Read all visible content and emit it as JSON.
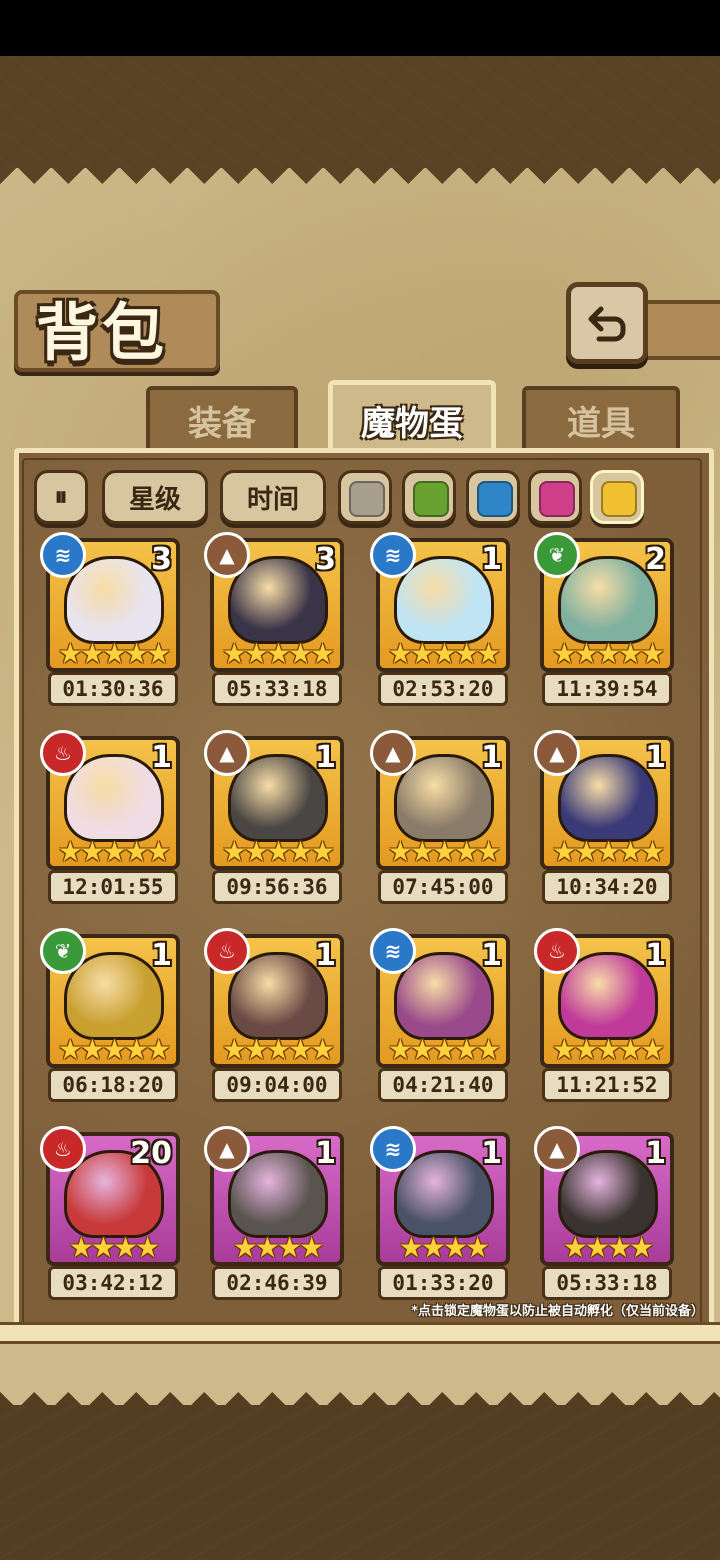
{
  "header": {
    "title": "背包",
    "back_icon": "back-arrow-icon"
  },
  "tabs": [
    {
      "label": "装备",
      "active": false
    },
    {
      "label": "魔物蛋",
      "active": true
    },
    {
      "label": "道具",
      "active": false
    }
  ],
  "filters": {
    "toggle_icon": "sort-toggle-icon",
    "star_label": "星级",
    "time_label": "时间",
    "colors": [
      {
        "name": "gray",
        "hex": "#a89e8c",
        "selected": false
      },
      {
        "name": "green",
        "hex": "#6aa232",
        "selected": false
      },
      {
        "name": "blue",
        "hex": "#2e86c8",
        "selected": false
      },
      {
        "name": "pink",
        "hex": "#d0408a",
        "selected": false
      },
      {
        "name": "gold",
        "hex": "#f0c030",
        "selected": true
      }
    ]
  },
  "eggs": [
    {
      "element": "water",
      "count": "3",
      "stars": "★★★★★",
      "timer": "01:30:36",
      "rarity": "gold",
      "color": "#e8e4f0"
    },
    {
      "element": "earth",
      "count": "3",
      "stars": "★★★★★",
      "timer": "05:33:18",
      "rarity": "gold",
      "color": "#3a3448"
    },
    {
      "element": "water",
      "count": "1",
      "stars": "★★★★★",
      "timer": "02:53:20",
      "rarity": "gold",
      "color": "#bfe4f4"
    },
    {
      "element": "wood",
      "count": "2",
      "stars": "★★★★★",
      "timer": "11:39:54",
      "rarity": "gold",
      "color": "#7fb0a0"
    },
    {
      "element": "fire",
      "count": "1",
      "stars": "★★★★★",
      "timer": "12:01:55",
      "rarity": "gold",
      "color": "#f0dce4"
    },
    {
      "element": "earth",
      "count": "1",
      "stars": "★★★★★",
      "timer": "09:56:36",
      "rarity": "gold",
      "color": "#4a4644"
    },
    {
      "element": "earth",
      "count": "1",
      "stars": "★★★★★",
      "timer": "07:45:00",
      "rarity": "gold",
      "color": "#8a7c6a"
    },
    {
      "element": "earth",
      "count": "1",
      "stars": "★★★★★",
      "timer": "10:34:20",
      "rarity": "gold",
      "color": "#3a3a78"
    },
    {
      "element": "wood",
      "count": "1",
      "stars": "★★★★★",
      "timer": "06:18:20",
      "rarity": "gold",
      "color": "#c8a030"
    },
    {
      "element": "fire",
      "count": "1",
      "stars": "★★★★★",
      "timer": "09:04:00",
      "rarity": "gold",
      "color": "#6a4a44"
    },
    {
      "element": "water",
      "count": "1",
      "stars": "★★★★★",
      "timer": "04:21:40",
      "rarity": "gold",
      "color": "#9a4a8a"
    },
    {
      "element": "fire",
      "count": "1",
      "stars": "★★★★★",
      "timer": "11:21:52",
      "rarity": "gold",
      "color": "#c03a9a"
    },
    {
      "element": "fire",
      "count": "20",
      "stars": "★★★★",
      "timer": "03:42:12",
      "rarity": "purple",
      "color": "#c83a3a"
    },
    {
      "element": "earth",
      "count": "1",
      "stars": "★★★★",
      "timer": "02:46:39",
      "rarity": "purple",
      "color": "#5a5450"
    },
    {
      "element": "water",
      "count": "1",
      "stars": "★★★★",
      "timer": "01:33:20",
      "rarity": "purple",
      "color": "#4a5268"
    },
    {
      "element": "earth",
      "count": "1",
      "stars": "★★★★",
      "timer": "05:33:18",
      "rarity": "purple",
      "color": "#3a3430"
    }
  ],
  "footer_note": "*点击锁定魔物蛋以防止被自动孵化（仅当前设备）"
}
